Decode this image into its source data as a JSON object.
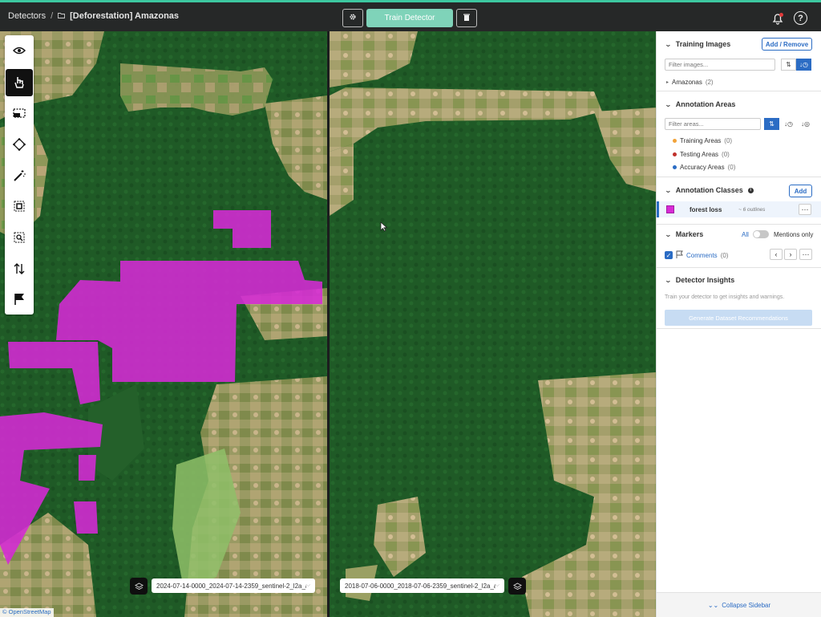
{
  "header": {
    "crumb_root": "Detectors",
    "crumb_sep": "/",
    "detector_name": "[Deforestation] Amazonas",
    "train_label": "Train Detector"
  },
  "map": {
    "left_date": "2024-07-14-0000_2024-07-14-2359_sentinel-2_l2a_a...",
    "right_date": "2018-07-06-0000_2018-07-06-2359_sentinel-2_l2a_a...",
    "attribution": "© OpenStreetMap",
    "overlay_color": "#d62ad6",
    "forest_color": "#1f5a26"
  },
  "sidebar": {
    "training": {
      "title": "Training Images",
      "add_remove": "Add / Remove",
      "filter_placeholder": "Filter images...",
      "group_name": "Amazonas",
      "group_count": "(2)"
    },
    "areas": {
      "title": "Annotation Areas",
      "filter_placeholder": "Filter areas...",
      "items": [
        {
          "label": "Training Areas",
          "count": "(0)",
          "color": "#f2a33a"
        },
        {
          "label": "Testing Areas",
          "count": "(0)",
          "color": "#c0302b"
        },
        {
          "label": "Accuracy Areas",
          "count": "(0)",
          "color": "#2b6cc4"
        }
      ]
    },
    "classes": {
      "title": "Annotation Classes",
      "add_label": "Add",
      "class_name": "forest loss",
      "class_meta": "~ 6 outlines",
      "class_color": "#d72ad6"
    },
    "markers": {
      "title": "Markers",
      "all_label": "All",
      "mentions_label": "Mentions only",
      "comments_label": "Comments",
      "comments_count": "(0)"
    },
    "insights": {
      "title": "Detector Insights",
      "hint": "Train your detector to get insights and warnings.",
      "generate_label": "Generate Dataset Recommendations"
    },
    "collapse_label": "Collapse Sidebar"
  }
}
